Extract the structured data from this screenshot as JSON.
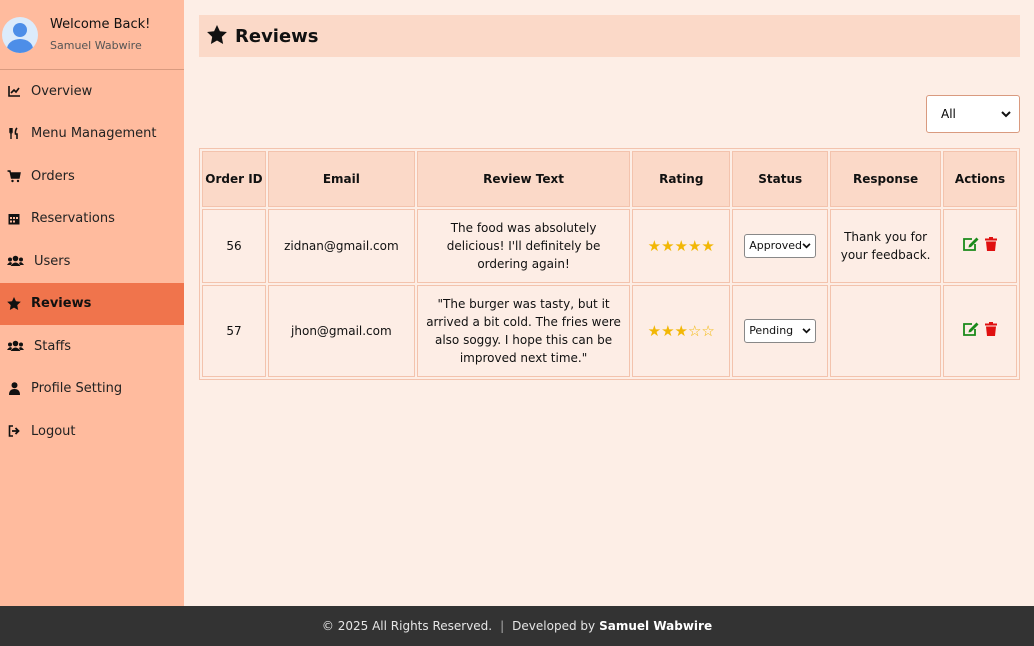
{
  "profile": {
    "welcome": "Welcome Back!",
    "name": "Samuel Wabwire"
  },
  "nav": [
    {
      "label": "Overview",
      "icon": "chart-line-icon"
    },
    {
      "label": "Menu Management",
      "icon": "utensils-icon"
    },
    {
      "label": "Orders",
      "icon": "shopping-cart-icon"
    },
    {
      "label": "Reservations",
      "icon": "calendar-icon"
    },
    {
      "label": "Users",
      "icon": "users-icon"
    },
    {
      "label": "Reviews",
      "icon": "star-icon",
      "active": true
    },
    {
      "label": "Staffs",
      "icon": "users-icon"
    },
    {
      "label": "Profile Setting",
      "icon": "user-icon"
    },
    {
      "label": "Logout",
      "icon": "sign-out-icon"
    }
  ],
  "page": {
    "title": "Reviews"
  },
  "filter": {
    "selected": "All"
  },
  "table": {
    "headers": [
      "Order ID",
      "Email",
      "Review Text",
      "Rating",
      "Status",
      "Response",
      "Actions"
    ],
    "rows": [
      {
        "order_id": "56",
        "email": "zidnan@gmail.com",
        "review": "The food was absolutely delicious! I'll definitely be ordering again!",
        "rating": 5,
        "rating_stars": "★★★★★",
        "status": "Approved",
        "response": "Thank you for your feedback."
      },
      {
        "order_id": "57",
        "email": "jhon@gmail.com",
        "review": "\"The burger was tasty, but it arrived a bit cold. The fries were also soggy. I hope this can be improved next time.\"",
        "rating": 3,
        "rating_stars": "★★★☆☆",
        "status": "Pending",
        "response": ""
      }
    ]
  },
  "footer": {
    "copyright": "© 2025 All Rights Reserved.",
    "separator": "|",
    "dev_prefix": "Developed by",
    "dev_name": "Samuel Wabwire"
  },
  "colors": {
    "sidebar": "#ffbb9e",
    "active": "#f0744c",
    "header": "#fbd9c8",
    "footer": "#333333",
    "star": "#f2b705",
    "edit": "#1a8a1a",
    "delete": "#e01010"
  }
}
